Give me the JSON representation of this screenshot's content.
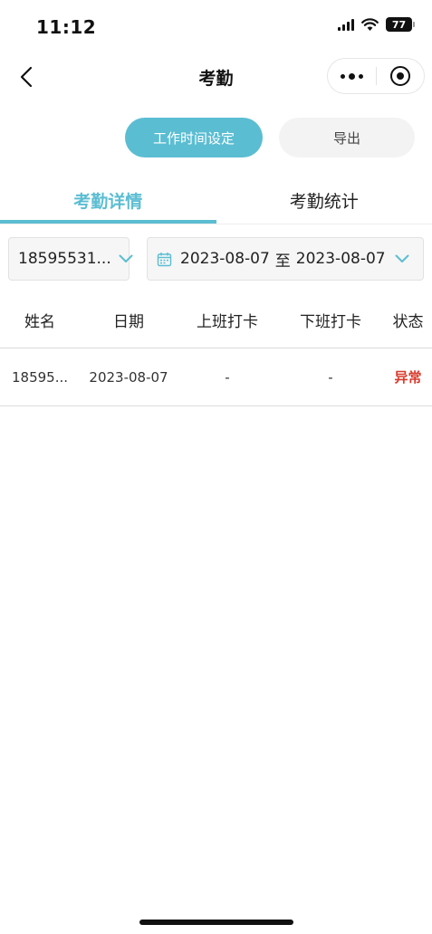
{
  "status_bar": {
    "time": "11:12",
    "battery": "77"
  },
  "nav": {
    "title": "考勤"
  },
  "actions": {
    "work_time_setting": "工作时间设定",
    "export": "导出"
  },
  "tabs": [
    {
      "label": "考勤详情",
      "active": true
    },
    {
      "label": "考勤统计",
      "active": false
    }
  ],
  "filters": {
    "user": "18595531...",
    "date_start": "2023-08-07",
    "date_separator": "至",
    "date_end": "2023-08-07"
  },
  "table": {
    "columns": [
      "姓名",
      "日期",
      "上班打卡",
      "下班打卡",
      "状态"
    ],
    "rows": [
      {
        "name": "18595...",
        "date": "2023-08-07",
        "clock_in": "-",
        "clock_out": "-",
        "status": "异常"
      }
    ]
  },
  "colors": {
    "accent": "#5bbdd2",
    "status_error": "#d93a2b"
  }
}
